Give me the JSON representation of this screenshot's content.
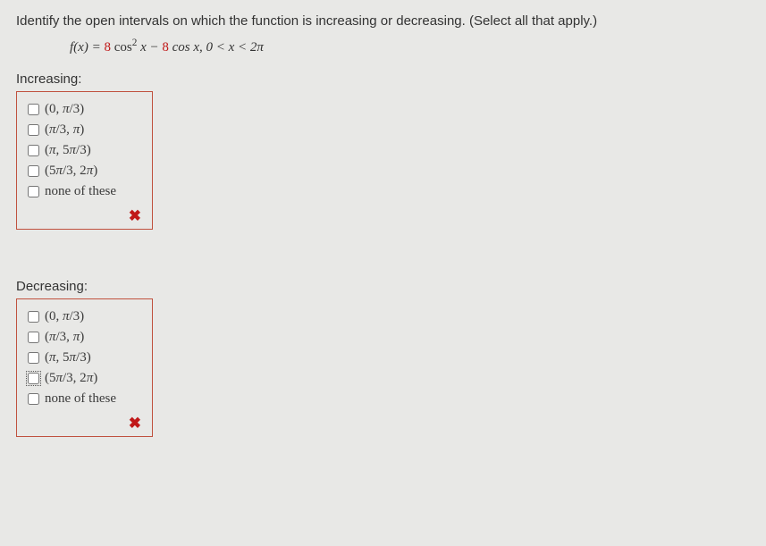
{
  "question": "Identify the open intervals on which the function is increasing or decreasing. (Select all that apply.)",
  "function": {
    "lhs": "f(x) = ",
    "coeff1": "8",
    "part1": " cos",
    "exp": "2",
    "part2": " x − ",
    "coeff2": "8",
    "part3": " cos x,  0 < x < 2",
    "pi": "π"
  },
  "increasing": {
    "label": "Increasing:",
    "options": [
      "(0, π/3)",
      "(π/3, π)",
      "(π, 5π/3)",
      "(5π/3, 2π)",
      "none of these"
    ],
    "feedback": "wrong"
  },
  "decreasing": {
    "label": "Decreasing:",
    "options": [
      "(0, π/3)",
      "(π/3, π)",
      "(π, 5π/3)",
      "(5π/3, 2π)",
      "none of these"
    ],
    "feedback": "wrong"
  }
}
